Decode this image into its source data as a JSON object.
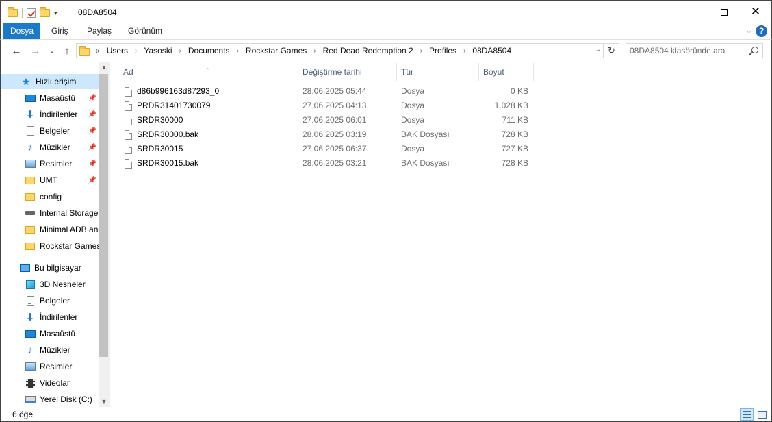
{
  "window": {
    "title": "08DA8504"
  },
  "ribbon": {
    "tabs": [
      "Dosya",
      "Giriş",
      "Paylaş",
      "Görünüm"
    ],
    "help": "?"
  },
  "address": {
    "overflow": "«",
    "crumbs": [
      "Users",
      "Yasoski",
      "Documents",
      "Rockstar Games",
      "Red Dead Redemption 2",
      "Profiles",
      "08DA8504"
    ]
  },
  "search": {
    "placeholder": "08DA8504 klasöründe ara"
  },
  "nav": {
    "quick_access": "Hızlı erişim",
    "quick_items": [
      {
        "label": "Masaüstü",
        "icon": "desktop-icon",
        "pinned": true
      },
      {
        "label": "İndirilenler",
        "icon": "downloads-icon",
        "pinned": true
      },
      {
        "label": "Belgeler",
        "icon": "documents-icon",
        "pinned": true
      },
      {
        "label": "Müzikler",
        "icon": "music-icon",
        "pinned": true
      },
      {
        "label": "Resimler",
        "icon": "pictures-icon",
        "pinned": true
      },
      {
        "label": "UMT",
        "icon": "folder-icon",
        "pinned": true
      },
      {
        "label": "config",
        "icon": "folder-icon",
        "pinned": false
      },
      {
        "label": "Internal Storage",
        "icon": "drive-icon",
        "pinned": false
      },
      {
        "label": "Minimal ADB and Fastboot",
        "icon": "folder-icon",
        "pinned": false
      },
      {
        "label": "Rockstar Games",
        "icon": "folder-icon",
        "pinned": false
      }
    ],
    "this_pc": "Bu bilgisayar",
    "pc_items": [
      {
        "label": "3D Nesneler",
        "icon": "3d-objects-icon"
      },
      {
        "label": "Belgeler",
        "icon": "documents-icon"
      },
      {
        "label": "İndirilenler",
        "icon": "downloads-icon"
      },
      {
        "label": "Masaüstü",
        "icon": "desktop-icon"
      },
      {
        "label": "Müzikler",
        "icon": "music-icon"
      },
      {
        "label": "Resimler",
        "icon": "pictures-icon"
      },
      {
        "label": "Videolar",
        "icon": "videos-icon"
      },
      {
        "label": "Yerel Disk (C:)",
        "icon": "local-disk-icon"
      }
    ]
  },
  "columns": {
    "name": "Ad",
    "date": "Değiştirme tarihi",
    "type": "Tür",
    "size": "Boyut"
  },
  "files": [
    {
      "name": "d86b996163d87293_0",
      "date": "28.06.2025 05:44",
      "type": "Dosya",
      "size": "0 KB"
    },
    {
      "name": "PRDR31401730079",
      "date": "27.06.2025 04:13",
      "type": "Dosya",
      "size": "1.028 KB"
    },
    {
      "name": "SRDR30000",
      "date": "27.06.2025 06:01",
      "type": "Dosya",
      "size": "711 KB"
    },
    {
      "name": "SRDR30000.bak",
      "date": "28.06.2025 03:19",
      "type": "BAK Dosyası",
      "size": "728 KB"
    },
    {
      "name": "SRDR30015",
      "date": "27.06.2025 06:37",
      "type": "Dosya",
      "size": "727 KB"
    },
    {
      "name": "SRDR30015.bak",
      "date": "28.06.2025 03:21",
      "type": "BAK Dosyası",
      "size": "728 KB"
    }
  ],
  "status": {
    "item_count": "6 öğe"
  },
  "colors": {
    "accent": "#1979ca",
    "selection": "#cce8ff"
  }
}
